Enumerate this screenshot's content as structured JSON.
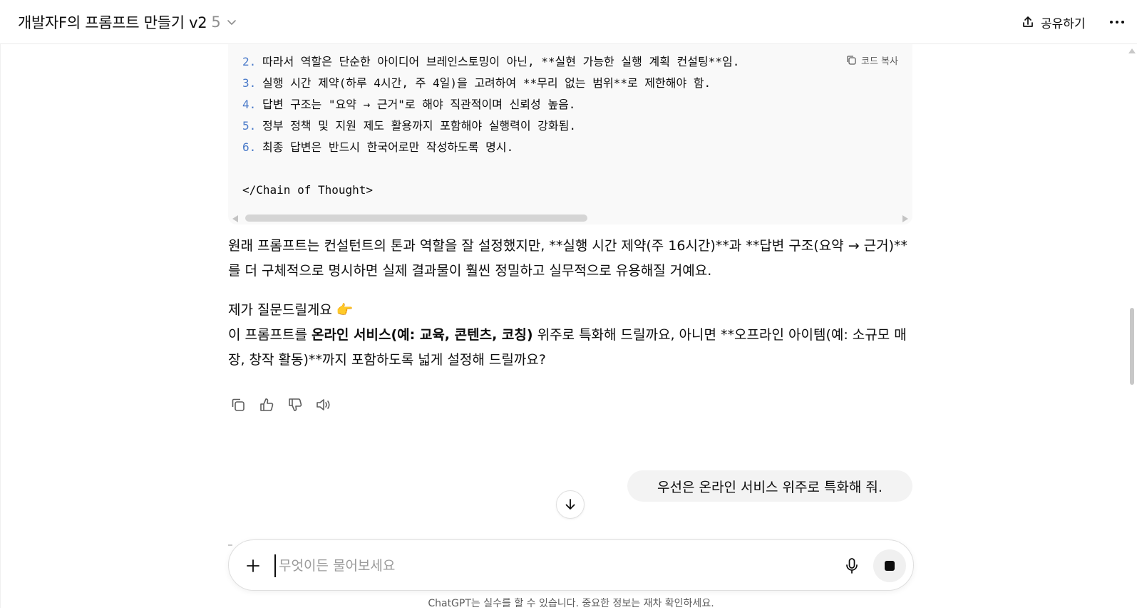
{
  "header": {
    "title": "개발자F의 프롬프트 만들기 v2",
    "version_count": "5",
    "share_label": "공유하기"
  },
  "code_block": {
    "copy_label": "코드 복사",
    "lines": [
      {
        "num": "2.",
        "text": "따라서 역할은 단순한 아이디어 브레인스토밍이 아닌, **실현 가능한 실행 계획 컨설팅**임."
      },
      {
        "num": "3.",
        "text": "실행 시간 제약(하루 4시간, 주 4일)을 고려하여 **무리 없는 범위**로 제한해야 함."
      },
      {
        "num": "4.",
        "text": "답변 구조는 \"요약 → 근거\"로 해야 직관적이며 신뢰성 높음."
      },
      {
        "num": "5.",
        "text": "정부 정책 및 지원 제도 활용까지 포함해야 실행력이 강화됨."
      },
      {
        "num": "6.",
        "text": "최종 답변은 반드시 한국어로만 작성하도록 명시."
      }
    ],
    "closing_tag": "</Chain of Thought>"
  },
  "assistant": {
    "para1": "원래 프롬프트는 컨설턴트의 톤과 역할을 잘 설정했지만, **실행 시간 제약(주 16시간)**과 **답변 구조(요약 → 근거)**를 더 구체적으로 명시하면 실제 결과물이 훨씬 정밀하고 실무적으로 유용해질 거예요.",
    "para2_line1": "제가 질문드릴게요 👉",
    "para2_prefix": "이 프롬프트를 ",
    "para2_bold": "온라인 서비스(예: 교육, 콘텐츠, 코칭)",
    "para2_suffix": " 위주로 특화해 드릴까요, 아니면 **오프라인 아이템(예: 소규모 매장, 창작 활동)**까지 포함하도록 넓게 설정해 드릴까요?"
  },
  "user_message": "우선은 온라인 서비스 위주로 특화해 줘.",
  "composer": {
    "placeholder": "무엇이든 물어보세요",
    "value": ""
  },
  "disclaimer": "ChatGPT는 실수를 할 수 있습니다. 중요한 정보는 재차 확인하세요.",
  "icons": {
    "share": "share-icon",
    "more": "more-horizontal-icon",
    "copy": "copy-icon",
    "thumbs_up": "thumbs-up-icon",
    "thumbs_down": "thumbs-down-icon",
    "read_aloud": "speaker-icon",
    "arrow_down": "arrow-down-icon",
    "plus": "plus-icon",
    "mic": "mic-icon",
    "stop": "stop-icon"
  }
}
